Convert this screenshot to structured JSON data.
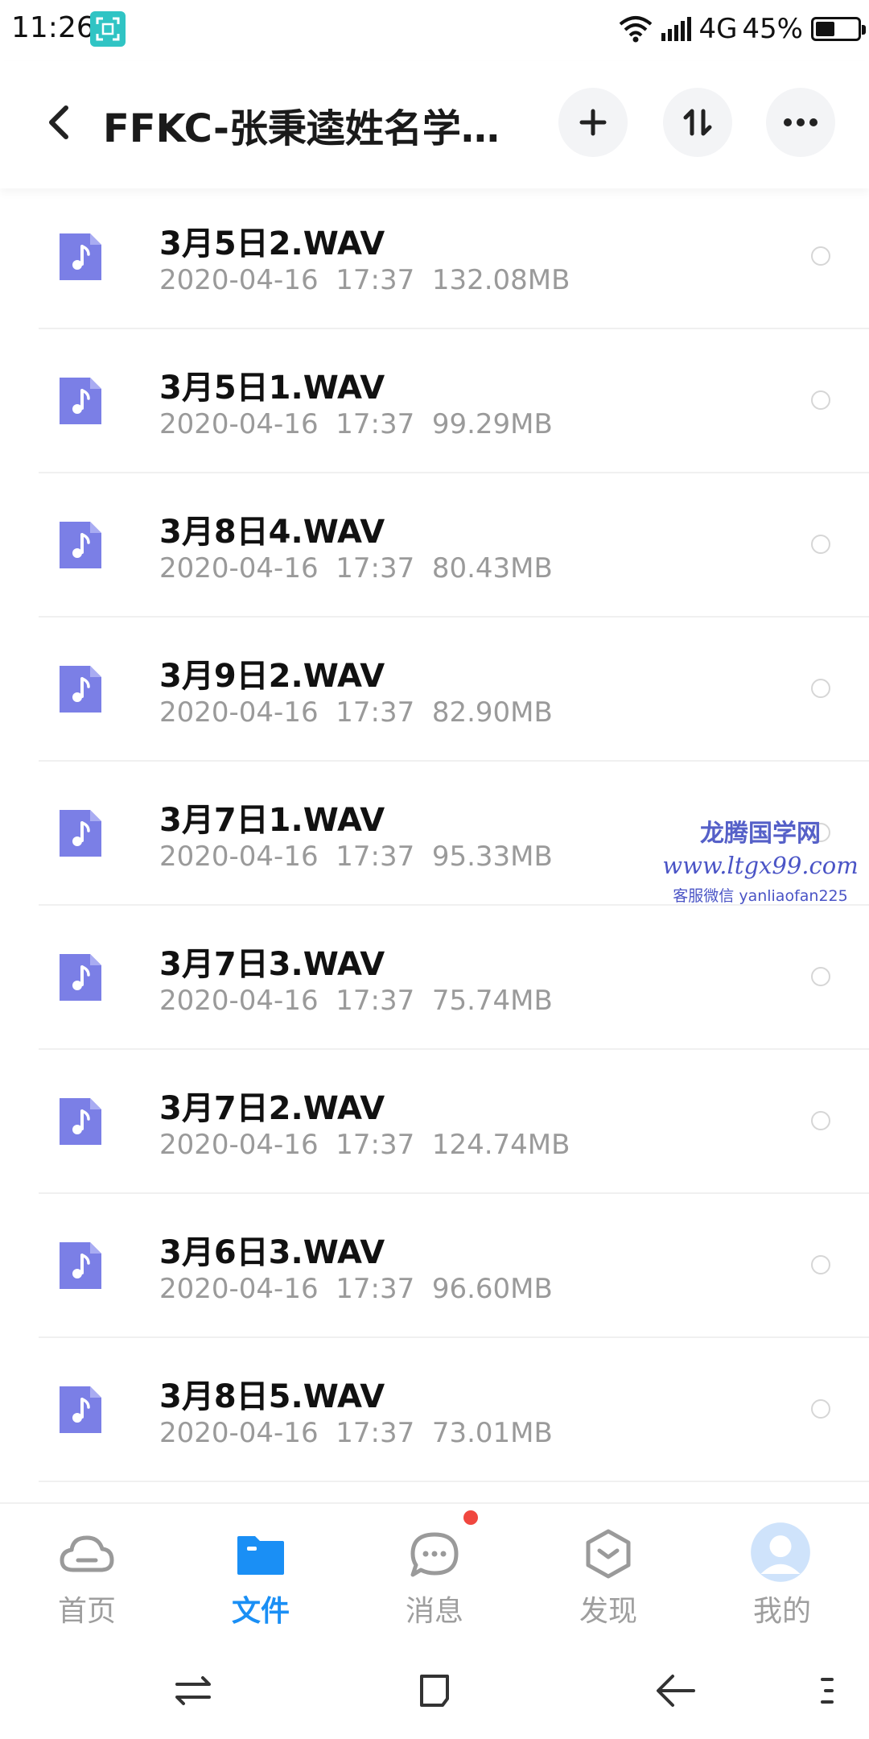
{
  "status_bar": {
    "time": "11:26",
    "network_label": "4G",
    "battery_percent": "45%",
    "battery_level": 0.45
  },
  "header": {
    "title": "FFKC-张秉逵姓名学面..."
  },
  "files": [
    {
      "name": "3月5日2.WAV",
      "date": "2020-04-16",
      "time": "17:37",
      "size": "132.08MB"
    },
    {
      "name": "3月5日1.WAV",
      "date": "2020-04-16",
      "time": "17:37",
      "size": "99.29MB"
    },
    {
      "name": "3月8日4.WAV",
      "date": "2020-04-16",
      "time": "17:37",
      "size": "80.43MB"
    },
    {
      "name": "3月9日2.WAV",
      "date": "2020-04-16",
      "time": "17:37",
      "size": "82.90MB"
    },
    {
      "name": "3月7日1.WAV",
      "date": "2020-04-16",
      "time": "17:37",
      "size": "95.33MB"
    },
    {
      "name": "3月7日3.WAV",
      "date": "2020-04-16",
      "time": "17:37",
      "size": "75.74MB"
    },
    {
      "name": "3月7日2.WAV",
      "date": "2020-04-16",
      "time": "17:37",
      "size": "124.74MB"
    },
    {
      "name": "3月6日3.WAV",
      "date": "2020-04-16",
      "time": "17:37",
      "size": "96.60MB"
    },
    {
      "name": "3月8日5.WAV",
      "date": "2020-04-16",
      "time": "17:37",
      "size": "73.01MB"
    }
  ],
  "watermark": {
    "line1": "龙腾国学网",
    "line2": "www.ltgx99.com",
    "line3": "客服微信 yanliaofan225"
  },
  "tabs": [
    {
      "label": "首页",
      "icon": "cloud-icon",
      "active": false
    },
    {
      "label": "文件",
      "icon": "folder-icon",
      "active": true
    },
    {
      "label": "消息",
      "icon": "chat-icon",
      "active": false
    },
    {
      "label": "发现",
      "icon": "discover-icon",
      "active": false
    },
    {
      "label": "我的",
      "icon": "avatar-icon",
      "active": false
    }
  ],
  "colors": {
    "accent": "#1a8ff5",
    "file_icon": "#7b7fe6",
    "badge": "#f0473f"
  }
}
